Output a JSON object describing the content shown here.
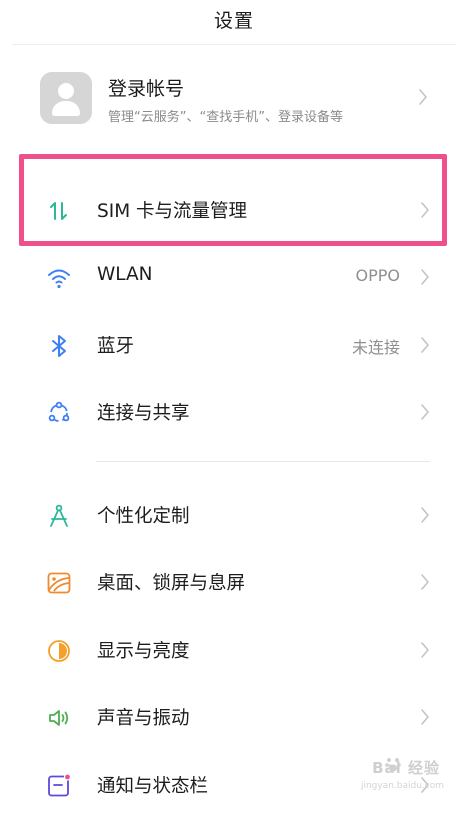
{
  "header": {
    "title": "设置"
  },
  "account": {
    "title": "登录帐号",
    "subtitle": "管理“云服务”、“查找手机”、登录设备等",
    "avatar_icon": "person-icon"
  },
  "settings_items": [
    {
      "label": "SIM 卡与流量管理",
      "value": "",
      "icon": "sim-data-icon",
      "highlighted": true
    },
    {
      "label": "WLAN",
      "value": "OPPO",
      "icon": "wifi-icon"
    },
    {
      "label": "蓝牙",
      "value": "未连接",
      "icon": "bluetooth-icon"
    },
    {
      "label": "连接与共享",
      "value": "",
      "icon": "connection-share-icon"
    },
    {
      "label": "个性化定制",
      "value": "",
      "icon": "compass-icon"
    },
    {
      "label": "桌面、锁屏与息屏",
      "value": "",
      "icon": "wallpaper-icon"
    },
    {
      "label": "显示与亮度",
      "value": "",
      "icon": "brightness-icon"
    },
    {
      "label": "声音与振动",
      "value": "",
      "icon": "speaker-icon"
    },
    {
      "label": "通知与状态栏",
      "value": "",
      "icon": "notification-icon"
    }
  ],
  "colors": {
    "highlight_border": "#f0508a",
    "sim_icon": "#2bb89a",
    "wifi_icon": "#3d7ff6",
    "bluetooth_icon": "#3d7ff6",
    "personalize_icon": "#2bb89a",
    "wallpaper_icon": "#f08a2e",
    "brightness_icon": "#f3a12b",
    "sound_icon": "#4caf50",
    "notification_icon": "#5a4bdc"
  },
  "watermark": {
    "main": "Bai 经验",
    "sub": "jingyan.baidu.com"
  }
}
